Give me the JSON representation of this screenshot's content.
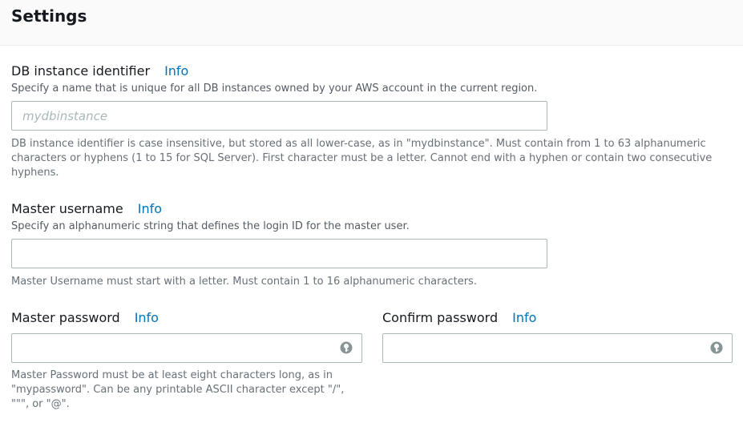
{
  "header": {
    "title": "Settings"
  },
  "db_identifier": {
    "label": "DB instance identifier",
    "info": "Info",
    "description": "Specify a name that is unique for all DB instances owned by your AWS account in the current region.",
    "placeholder": "mydbinstance",
    "value": "",
    "constraint": "DB instance identifier is case insensitive, but stored as all lower-case, as in \"mydbinstance\". Must contain from 1 to 63 alphanumeric characters or hyphens (1 to 15 for SQL Server). First character must be a letter. Cannot end with a hyphen or contain two consecutive hyphens."
  },
  "master_username": {
    "label": "Master username",
    "info": "Info",
    "description": "Specify an alphanumeric string that defines the login ID for the master user.",
    "value": "",
    "constraint": "Master Username must start with a letter. Must contain 1 to 16 alphanumeric characters."
  },
  "master_password": {
    "label": "Master password",
    "info": "Info",
    "value": "",
    "icon": "password-key-icon",
    "constraint": "Master Password must be at least eight characters long, as in \"mypassword\". Can be any printable ASCII character except \"/\", \"\"\", or \"@\"."
  },
  "confirm_password": {
    "label": "Confirm password",
    "info": "Info",
    "value": "",
    "icon": "password-key-icon"
  },
  "colors": {
    "link": "#0073bb",
    "text": "#16191f",
    "muted": "#545b64",
    "border": "#aab7b8"
  }
}
